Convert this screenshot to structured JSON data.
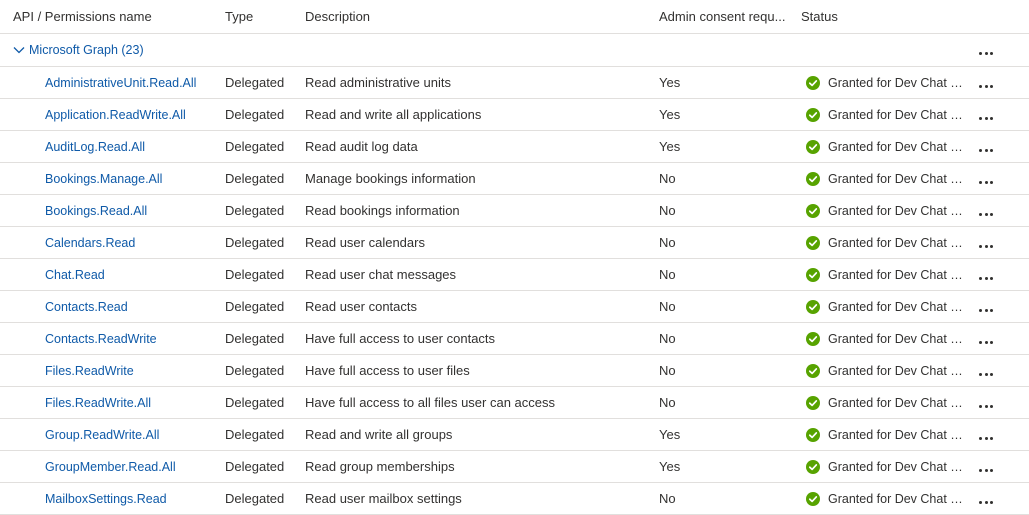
{
  "columns": {
    "name": "API / Permissions name",
    "type": "Type",
    "description": "Description",
    "admin_consent": "Admin consent requ...",
    "status": "Status"
  },
  "group": {
    "label": "Microsoft Graph (23)"
  },
  "colors": {
    "link": "#0f5aa8",
    "granted": "#57a300",
    "border": "#e1dfdd"
  },
  "rows": [
    {
      "name": "AdministrativeUnit.Read.All",
      "type": "Delegated",
      "description": "Read administrative units",
      "admin": "Yes",
      "status": "Granted for Dev Chat Su..."
    },
    {
      "name": "Application.ReadWrite.All",
      "type": "Delegated",
      "description": "Read and write all applications",
      "admin": "Yes",
      "status": "Granted for Dev Chat Su..."
    },
    {
      "name": "AuditLog.Read.All",
      "type": "Delegated",
      "description": "Read audit log data",
      "admin": "Yes",
      "status": "Granted for Dev Chat Su..."
    },
    {
      "name": "Bookings.Manage.All",
      "type": "Delegated",
      "description": "Manage bookings information",
      "admin": "No",
      "status": "Granted for Dev Chat Su..."
    },
    {
      "name": "Bookings.Read.All",
      "type": "Delegated",
      "description": "Read bookings information",
      "admin": "No",
      "status": "Granted for Dev Chat Su..."
    },
    {
      "name": "Calendars.Read",
      "type": "Delegated",
      "description": "Read user calendars",
      "admin": "No",
      "status": "Granted for Dev Chat Su..."
    },
    {
      "name": "Chat.Read",
      "type": "Delegated",
      "description": "Read user chat messages",
      "admin": "No",
      "status": "Granted for Dev Chat Su..."
    },
    {
      "name": "Contacts.Read",
      "type": "Delegated",
      "description": "Read user contacts",
      "admin": "No",
      "status": "Granted for Dev Chat Su..."
    },
    {
      "name": "Contacts.ReadWrite",
      "type": "Delegated",
      "description": "Have full access to user contacts",
      "admin": "No",
      "status": "Granted for Dev Chat Su..."
    },
    {
      "name": "Files.ReadWrite",
      "type": "Delegated",
      "description": "Have full access to user files",
      "admin": "No",
      "status": "Granted for Dev Chat Su..."
    },
    {
      "name": "Files.ReadWrite.All",
      "type": "Delegated",
      "description": "Have full access to all files user can access",
      "admin": "No",
      "status": "Granted for Dev Chat Su..."
    },
    {
      "name": "Group.ReadWrite.All",
      "type": "Delegated",
      "description": "Read and write all groups",
      "admin": "Yes",
      "status": "Granted for Dev Chat Su..."
    },
    {
      "name": "GroupMember.Read.All",
      "type": "Delegated",
      "description": "Read group memberships",
      "admin": "Yes",
      "status": "Granted for Dev Chat Su..."
    },
    {
      "name": "MailboxSettings.Read",
      "type": "Delegated",
      "description": "Read user mailbox settings",
      "admin": "No",
      "status": "Granted for Dev Chat Su..."
    }
  ]
}
